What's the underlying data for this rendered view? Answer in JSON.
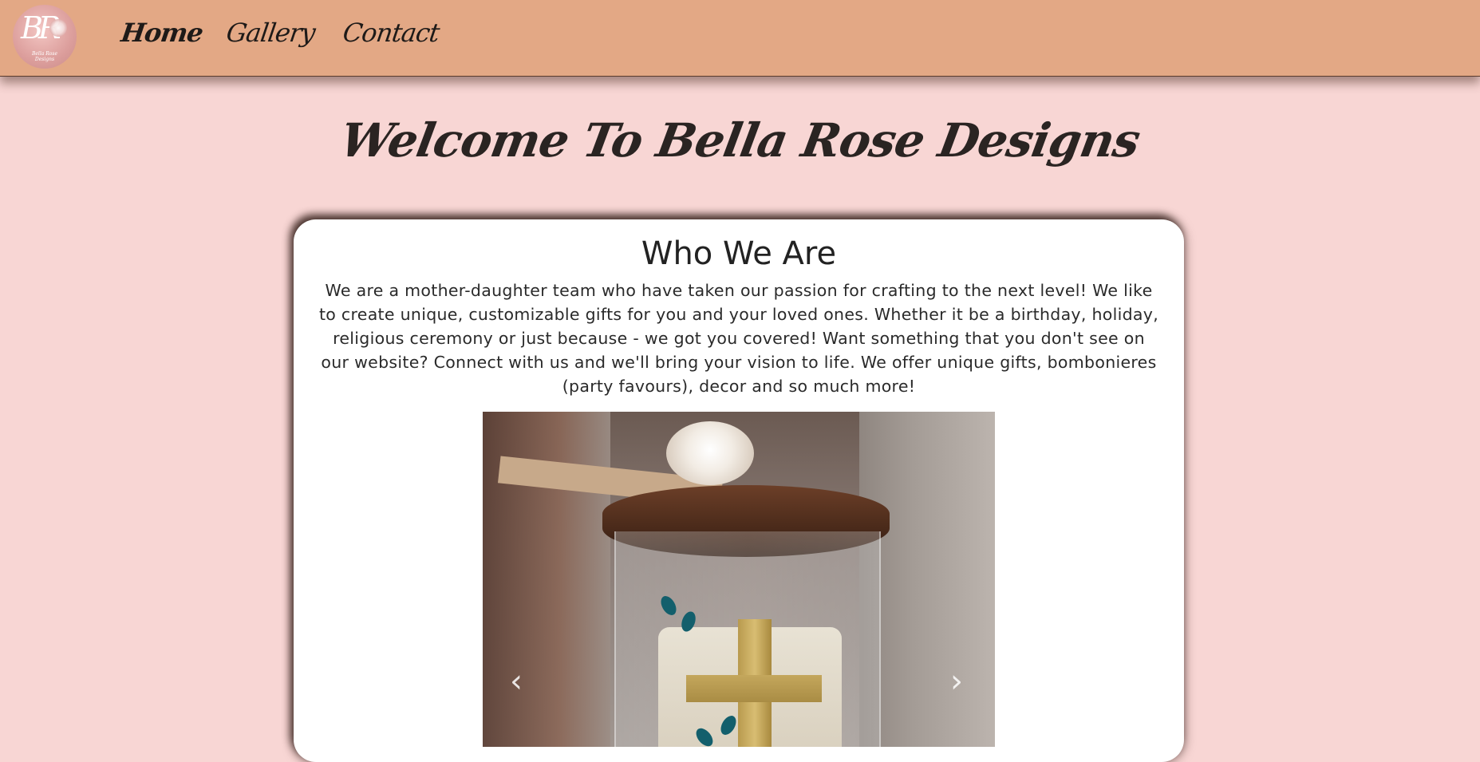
{
  "nav": {
    "logo_monogram": "BR",
    "logo_text": "Bella Rose Designs",
    "links": [
      {
        "label": "Home"
      },
      {
        "label": "Gallery"
      },
      {
        "label": "Contact"
      }
    ]
  },
  "hero": {
    "title": "Welcome To Bella Rose Designs"
  },
  "about": {
    "heading": "Who We Are",
    "body": "We are a mother-daughter team who have taken our passion for crafting to the next level! We like to create unique, customizable gifts for you and your loved ones. Whether it be a birthday, holiday, religious ceremony or just because - we got you covered! Want something that you don't see on our website? Connect with us and we'll bring your vision to life. We offer unique gifts, bombonieres (party favours), decor and so much more!"
  },
  "carousel": {
    "prev_glyph": "‹",
    "next_glyph": "›"
  },
  "colors": {
    "navbar": "#e3a885",
    "page_background": "#f8d6d4",
    "card_background": "#ffffff"
  }
}
